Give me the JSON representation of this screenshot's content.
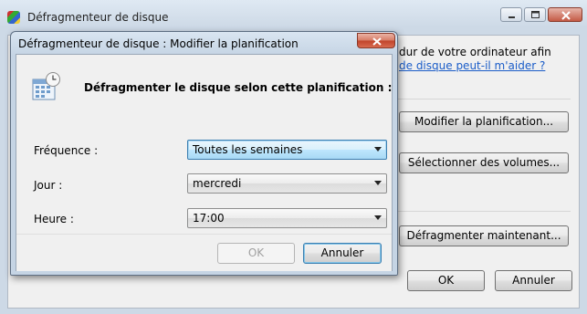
{
  "main_window": {
    "title": "Défragmenteur de disque",
    "text_line": "dur de votre ordinateur afin",
    "help_link": "de disque peut-il m'aider ?",
    "modify_schedule_label": "Modifier la planification...",
    "select_volumes_label": "Sélectionner des volumes...",
    "defragment_now_label": "Défragmenter maintenant...",
    "ok_label": "OK",
    "cancel_label": "Annuler"
  },
  "dialog": {
    "title": "Défragmenteur de disque : Modifier la planification",
    "heading": "Défragmenter le disque selon cette planification :",
    "frequency": {
      "label": "Fréquence :",
      "value": "Toutes les semaines"
    },
    "day": {
      "label": "Jour :",
      "value": "mercredi"
    },
    "time": {
      "label": "Heure :",
      "value": "17:00"
    },
    "ok_label": "OK",
    "cancel_label": "Annuler"
  }
}
